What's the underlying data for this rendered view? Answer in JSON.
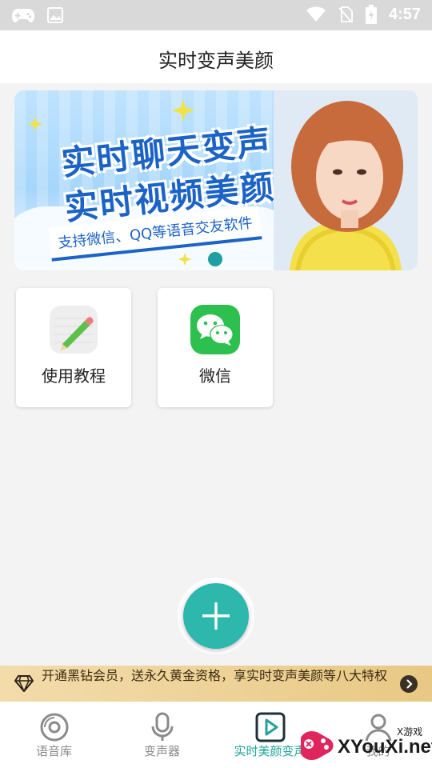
{
  "status_bar": {
    "time": "4:57"
  },
  "header": {
    "title": "实时变声美颜"
  },
  "banner": {
    "line1": "实时聊天变声",
    "line2": "实时视频美颜",
    "subtitle": "支持微信、QQ等语音交友软件"
  },
  "cards": [
    {
      "label": "使用教程",
      "icon": "pencil-icon"
    },
    {
      "label": "微信",
      "icon": "wechat-icon"
    }
  ],
  "vip_bar": {
    "text": "开通黑钻会员，送永久黄金资格，享实时变声美颜等八大特权"
  },
  "tabs": [
    {
      "label": "语音库",
      "icon": "disc-icon",
      "active": false
    },
    {
      "label": "变声器",
      "icon": "microphone-icon",
      "active": false
    },
    {
      "label": "实时美颜变声",
      "icon": "play-icon",
      "active": true
    },
    {
      "label": "我的",
      "icon": "profile-icon",
      "active": false
    }
  ],
  "watermark": {
    "small": "X游戏",
    "text": "XYouXi.net"
  },
  "colors": {
    "accent": "#21a39a",
    "fab": "#2db7ad",
    "vip_gold": "#e8c884"
  }
}
